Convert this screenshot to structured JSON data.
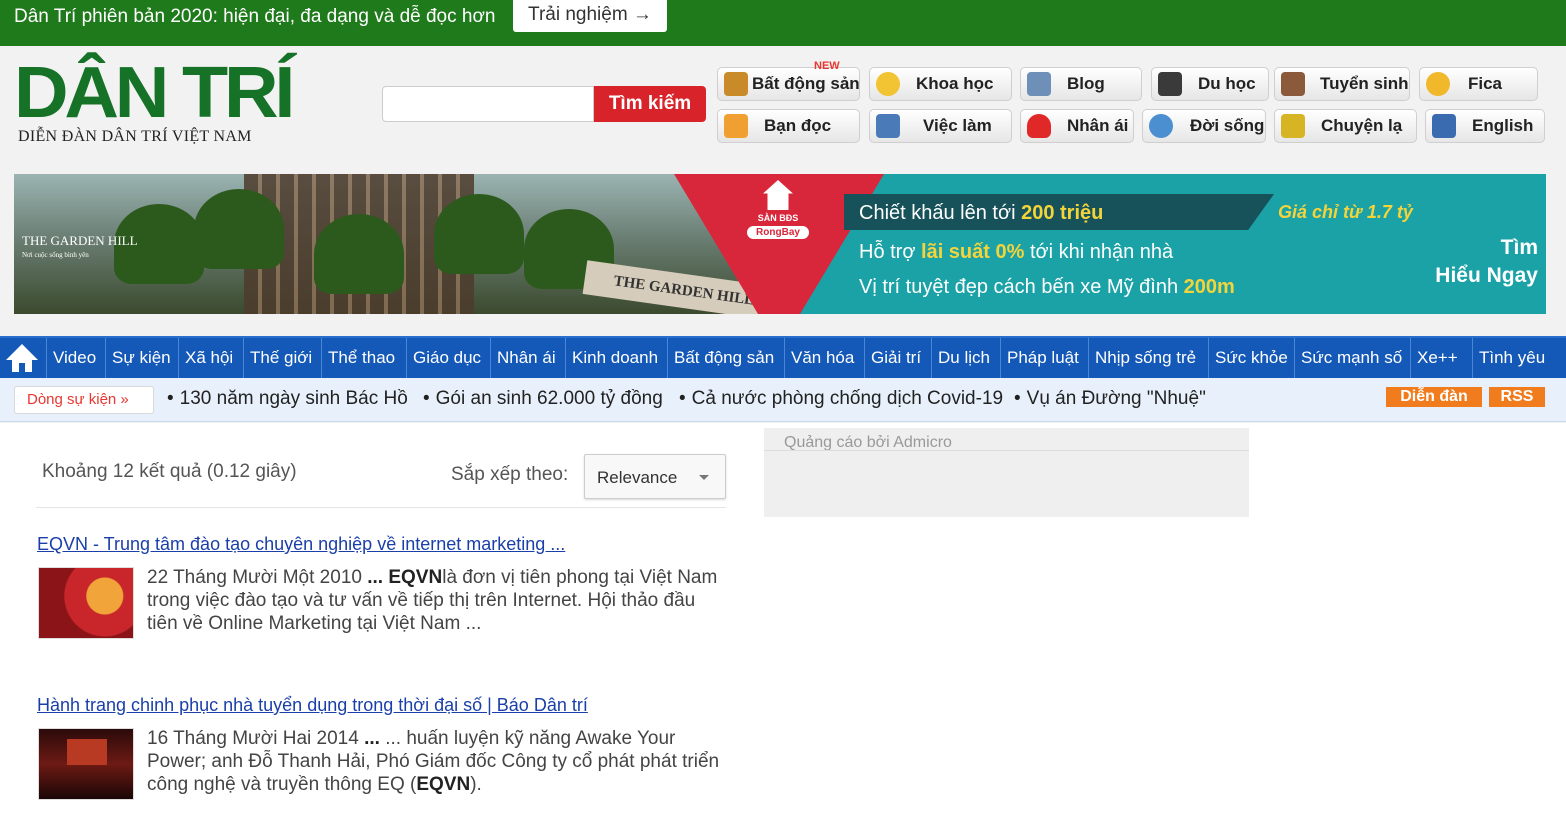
{
  "promo": {
    "text": "Dân Trí phiên bản 2020: hiện đại, đa dạng và dễ đọc hơn",
    "button": "Trải nghiệm →"
  },
  "logo": {
    "main": "DÂN TRÍ",
    "sub": "DIỄN ĐÀN DÂN TRÍ VIỆT NAM"
  },
  "search": {
    "placeholder": "",
    "button": "Tìm kiếm"
  },
  "quick_links": [
    {
      "label": "Bất động sản",
      "icon": "hammer-icon",
      "badge": "NEW"
    },
    {
      "label": "Khoa học",
      "icon": "lightbulb-icon"
    },
    {
      "label": "Blog",
      "icon": "people-icon"
    },
    {
      "label": "Du học",
      "icon": "graduation-cap-icon"
    },
    {
      "label": "Tuyển sinh",
      "icon": "student-icon"
    },
    {
      "label": "Fica",
      "icon": "coins-icon"
    },
    {
      "label": "Bạn đọc",
      "icon": "hand-icon"
    },
    {
      "label": "Việc làm",
      "icon": "workers-icon"
    },
    {
      "label": "Nhân ái",
      "icon": "heart-icon"
    },
    {
      "label": "Đời sống",
      "icon": "globe-icon"
    },
    {
      "label": "Chuyện lạ",
      "icon": "bird-icon"
    },
    {
      "label": "English",
      "icon": "book-icon"
    }
  ],
  "banner": {
    "brand": "THE GARDEN HILL",
    "brand_tagline": "Nơi cuộc sống bình yên",
    "sign": "THE GARDEN HILL",
    "partner_line1": "SÀN BĐS",
    "partner_line2": "RongBay",
    "line1_pre": "Chiết khấu lên tới ",
    "line1_hl": "200 triệu",
    "line2_pre": "Hỗ trợ ",
    "line2_hl": "lãi suất 0%",
    "line2_post": " tới khi nhận nhà",
    "line3_pre": "Vị trí tuyệt đẹp cách bến xe Mỹ đình ",
    "line3_hl": "200m",
    "price": "Giá chỉ từ 1.7 tỷ",
    "cta1": "Tìm",
    "cta2": "Hiểu Ngay"
  },
  "nav": {
    "home_icon": "home-icon",
    "items": [
      "Video",
      "Sự kiện",
      "Xã hội",
      "Thế giới",
      "Thể thao",
      "Giáo dục",
      "Nhân ái",
      "Kinh doanh",
      "Bất động sản",
      "Văn hóa",
      "Giải trí",
      "Du lịch",
      "Pháp luật",
      "Nhịp sống trẻ",
      "Sức khỏe",
      "Sức mạnh số",
      "Xe++",
      "Tình yêu"
    ]
  },
  "events": {
    "label": "Dòng sự kiện »",
    "items": [
      "130 năm ngày sinh Bác Hồ",
      "Gói an sinh 62.000 tỷ đồng",
      "Cả nước phòng chống dịch Covid-19",
      "Vụ án Đường \"Nhuệ\""
    ],
    "forum_button": "Diễn đàn",
    "rss_button": "RSS"
  },
  "results": {
    "count": "Khoảng 12 kết quả (0.12 giây)",
    "sort_label": "Sắp xếp theo:",
    "sort_value": "Relevance",
    "items": [
      {
        "title": "EQVN - Trung tâm đào tạo chuyên nghiệp về internet marketing ...",
        "date": "22 Tháng Mười Một 2010",
        "ellipsis": " ... ",
        "bold": "EQVN",
        "snippet": "là đơn vị tiên phong tại Việt Nam trong việc đào tạo và tư vấn về tiếp thị trên Internet. Hội thảo đầu tiên về Online Marketing tại Việt Nam ..."
      },
      {
        "title": "Hành trang chinh phục nhà tuyển dụng trong thời đại số | Báo Dân trí",
        "date": "16 Tháng Mười Hai 2014",
        "ellipsis": " ... ",
        "snippet": "... huấn luyện kỹ năng Awake Your Power; anh Đỗ Thanh Hải, Phó Giám đốc Công ty cổ phát phát triển công nghệ và truyền thông EQ (",
        "bold": "EQVN",
        "snippet_end": ")."
      }
    ]
  },
  "ad": {
    "label": "Quảng cáo bởi Admicro"
  },
  "colors": {
    "promo_bg": "#1e7a1a",
    "logo": "#167226",
    "search_btn": "#d8232a",
    "nav_bg": "#1458b8",
    "link": "#1a3fa8",
    "event_label": "#e8372e",
    "event_btn": "#f07c1e"
  }
}
